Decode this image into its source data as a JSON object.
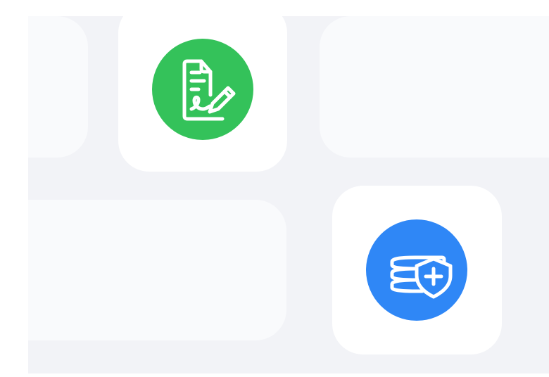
{
  "tiles": [
    {
      "id": "tile-1",
      "kind": "placeholder"
    },
    {
      "id": "tile-2",
      "kind": "app",
      "icon": "signed-document-icon",
      "color": "#34c25a"
    },
    {
      "id": "tile-3",
      "kind": "placeholder"
    },
    {
      "id": "tile-4",
      "kind": "placeholder"
    },
    {
      "id": "tile-5",
      "kind": "app",
      "icon": "secure-database-icon",
      "color": "#2f87f6"
    }
  ],
  "colors": {
    "canvas": "#f2f3f7",
    "placeholder": "#f9fafc",
    "card": "#ffffff",
    "icon_stroke": "#ffffff"
  }
}
